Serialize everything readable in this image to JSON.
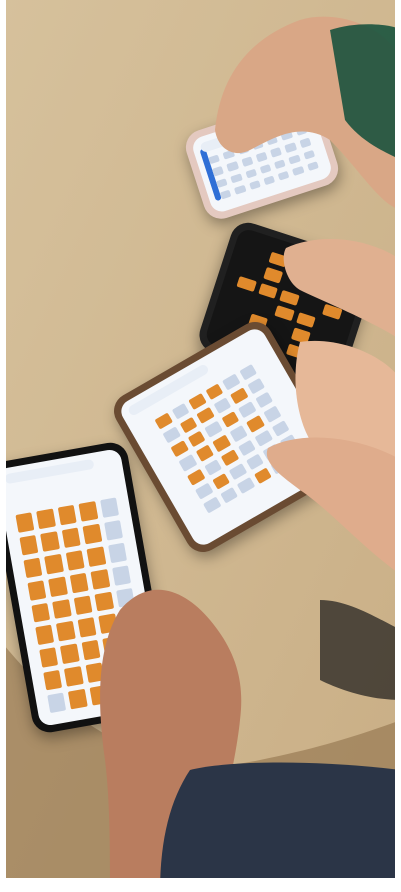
{
  "scene": {
    "table_color": "#d9c29c",
    "tile_on_color": "#e08a2c",
    "tile_off_color": "#c8d4e6",
    "light_screen_color": "#f4f7fb",
    "dark_screen_color": "#151515",
    "phones": [
      {
        "name": "phone-top",
        "frame": "#e4c9c0",
        "screen": "light",
        "rows": 4,
        "cols": 7,
        "lit": []
      },
      {
        "name": "phone-dark",
        "frame": "#202020",
        "screen": "dark",
        "rows": 6,
        "cols": 5,
        "lit": [
          [
            0,
            1
          ],
          [
            1,
            1
          ],
          [
            1,
            3
          ],
          [
            2,
            0
          ],
          [
            2,
            1
          ],
          [
            2,
            2
          ],
          [
            2,
            4
          ],
          [
            3,
            2
          ],
          [
            3,
            3
          ],
          [
            4,
            1
          ],
          [
            4,
            3
          ],
          [
            5,
            3
          ]
        ]
      },
      {
        "name": "phone-middle",
        "frame": "#6a4b32",
        "screen": "light",
        "rows": 7,
        "cols": 6,
        "lit": [
          [
            0,
            0
          ],
          [
            0,
            2
          ],
          [
            0,
            3
          ],
          [
            1,
            1
          ],
          [
            1,
            2
          ],
          [
            1,
            4
          ],
          [
            2,
            0
          ],
          [
            2,
            1
          ],
          [
            2,
            3
          ],
          [
            3,
            1
          ],
          [
            3,
            2
          ],
          [
            3,
            4
          ],
          [
            4,
            0
          ],
          [
            4,
            2
          ],
          [
            5,
            1
          ],
          [
            6,
            3
          ]
        ]
      },
      {
        "name": "phone-left",
        "frame": "#111111",
        "screen": "light",
        "rows": 9,
        "cols": 5,
        "lit": [
          [
            0,
            0
          ],
          [
            0,
            1
          ],
          [
            0,
            2
          ],
          [
            0,
            3
          ],
          [
            1,
            0
          ],
          [
            1,
            1
          ],
          [
            1,
            2
          ],
          [
            1,
            3
          ],
          [
            2,
            0
          ],
          [
            2,
            1
          ],
          [
            2,
            2
          ],
          [
            2,
            3
          ],
          [
            3,
            0
          ],
          [
            3,
            1
          ],
          [
            3,
            2
          ],
          [
            3,
            3
          ],
          [
            4,
            0
          ],
          [
            4,
            1
          ],
          [
            4,
            2
          ],
          [
            4,
            3
          ],
          [
            5,
            0
          ],
          [
            5,
            1
          ],
          [
            5,
            2
          ],
          [
            5,
            3
          ],
          [
            6,
            0
          ],
          [
            6,
            1
          ],
          [
            6,
            2
          ],
          [
            6,
            3
          ],
          [
            7,
            0
          ],
          [
            7,
            1
          ],
          [
            7,
            2
          ],
          [
            8,
            1
          ],
          [
            8,
            2
          ]
        ]
      }
    ]
  }
}
